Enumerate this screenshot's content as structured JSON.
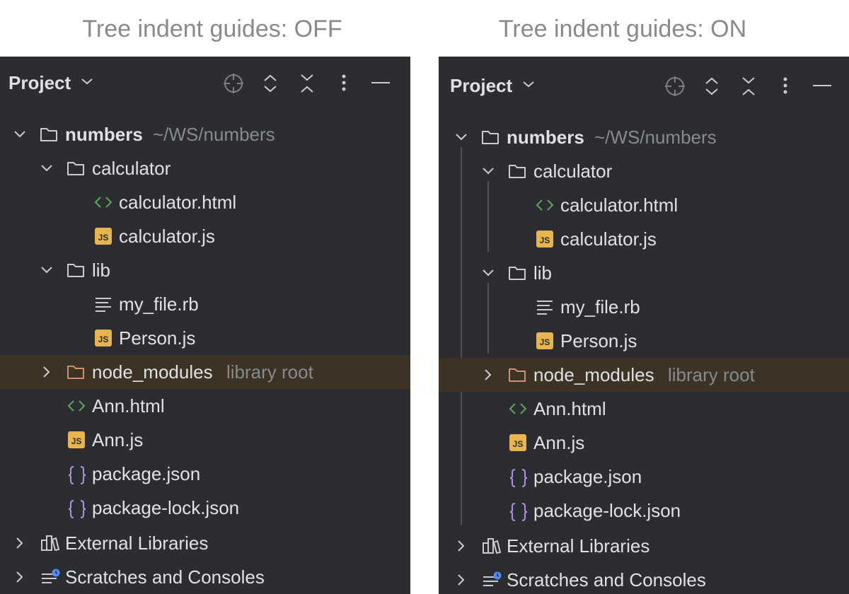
{
  "captions": {
    "off": "Tree indent guides: OFF",
    "on": "Tree indent guides: ON"
  },
  "header": {
    "title": "Project",
    "icons": [
      "locate-icon",
      "expand-all-icon",
      "collapse-all-icon",
      "more-options-icon",
      "minimize-icon"
    ]
  },
  "tree": {
    "root_name": "numbers",
    "root_path": "~/WS/numbers",
    "calculator": "calculator",
    "calculator_html": "calculator.html",
    "calculator_js": "calculator.js",
    "lib": "lib",
    "my_file": "my_file.rb",
    "person": "Person.js",
    "node_modules": "node_modules",
    "node_modules_hint": "library root",
    "ann_html": "Ann.html",
    "ann_js": "Ann.js",
    "package_json": "package.json",
    "package_lock": "package-lock.json",
    "external_libraries": "External Libraries",
    "scratches": "Scratches and Consoles"
  },
  "icon_badges": {
    "js": "JS",
    "html": "<>",
    "json": "{}"
  },
  "colors": {
    "panel_bg": "#2b2d30",
    "text": "#dfe1e5",
    "hint": "#868a91",
    "highlight_row": "#3d3324",
    "guide_line": "#4e5157",
    "js_badge": "#e8b54c",
    "html_icon": "#5fa55a",
    "json_icon": "#b48ee6",
    "excluded_folder": "#c7917a",
    "scratch_dot": "#548af7"
  }
}
